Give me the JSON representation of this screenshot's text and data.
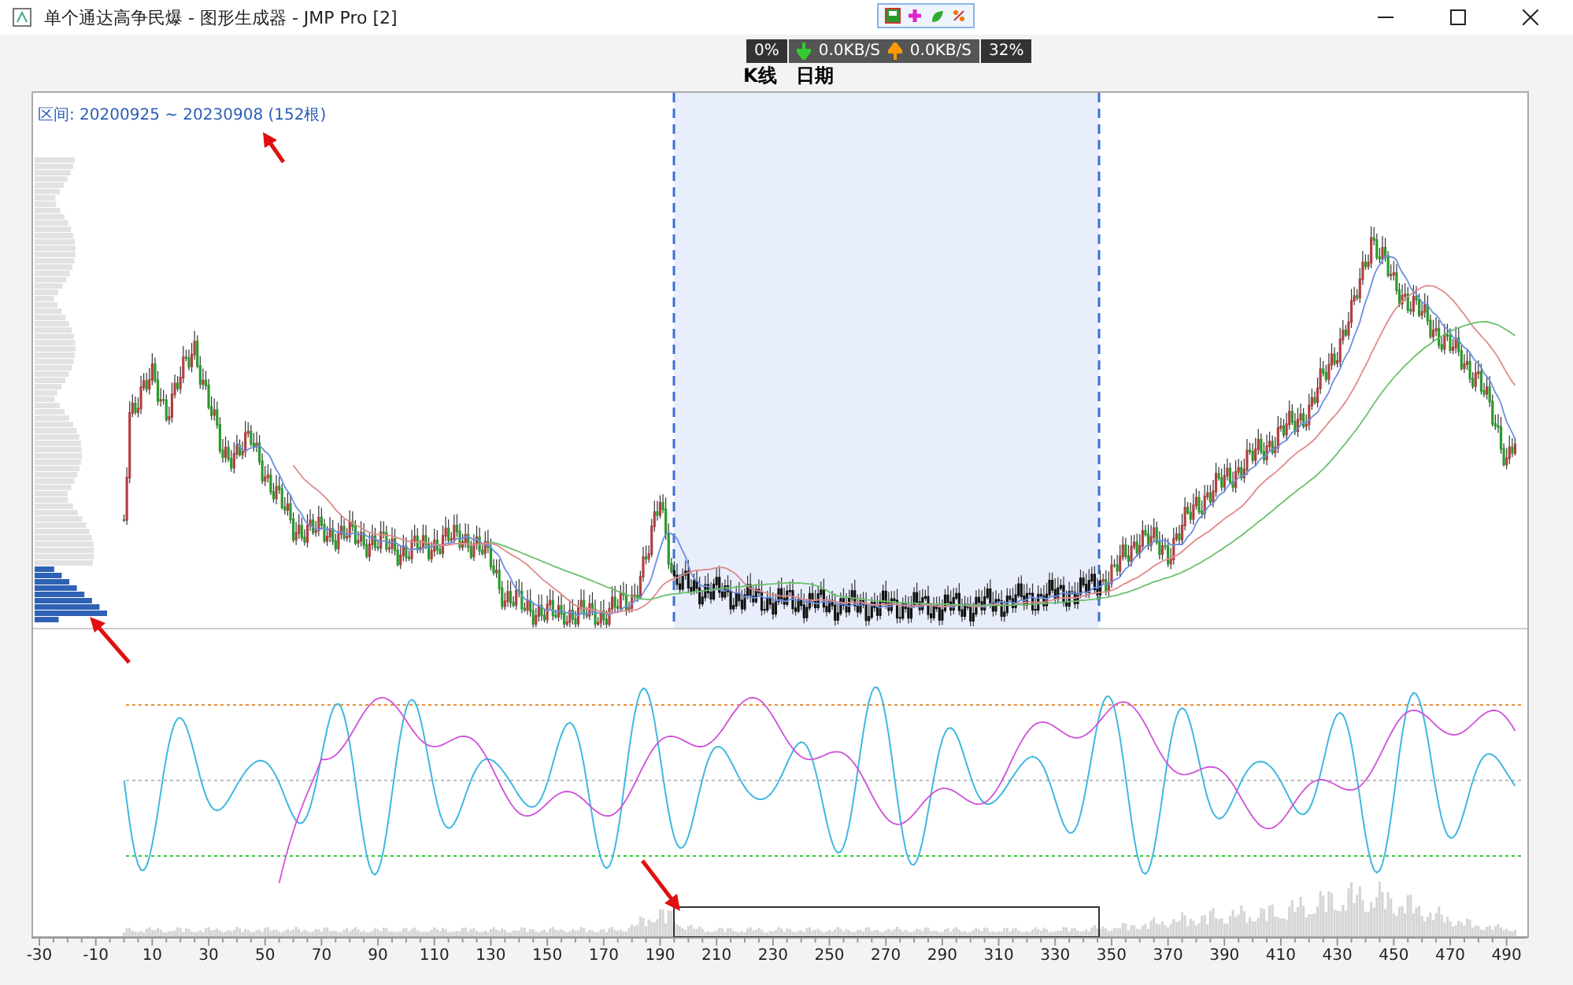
{
  "window": {
    "title": "单个通达高争民爆 - 图形生成器 - JMP Pro [2]"
  },
  "network_monitor": {
    "cpu": "0%",
    "download": "0.0KB/S",
    "upload": "0.0KB/S",
    "memory": "32%"
  },
  "chart": {
    "title_parts": [
      "K线",
      "日期"
    ],
    "range_label": "区间: 20200925 ~ 20230908 (152根)",
    "x_ticks": [
      "-30",
      "-10",
      "10",
      "30",
      "50",
      "70",
      "90",
      "110",
      "130",
      "150",
      "170",
      "190",
      "210",
      "230",
      "250",
      "270",
      "290",
      "310",
      "330",
      "350",
      "370",
      "390",
      "410",
      "430",
      "450",
      "470",
      "490"
    ]
  }
}
